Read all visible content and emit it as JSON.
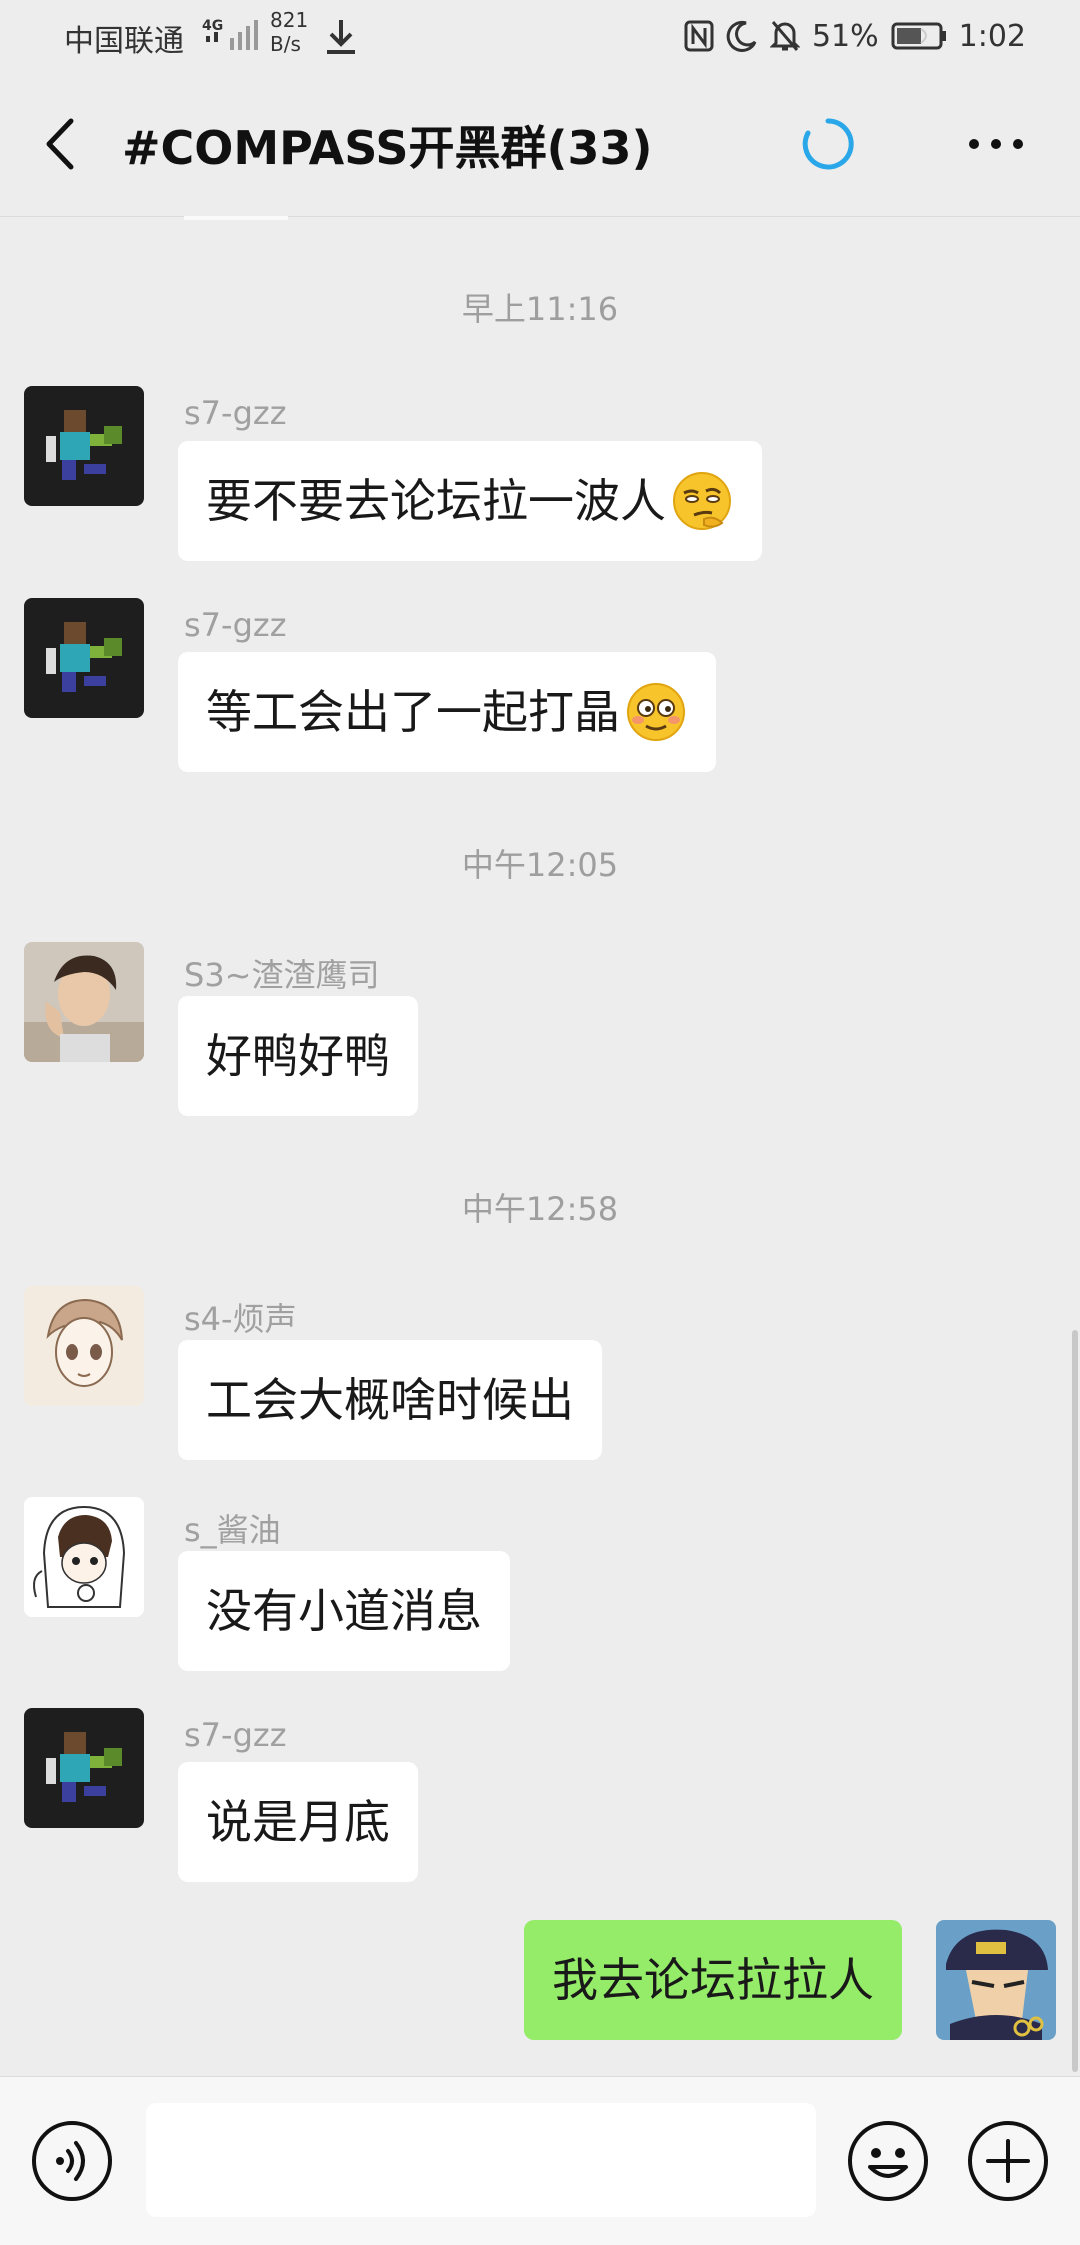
{
  "status_bar": {
    "carrier": "中国联通",
    "network": "4G",
    "speed_value": "821",
    "speed_unit": "B/s",
    "battery": "51%",
    "time": "1:02"
  },
  "header": {
    "title": "#COMPASS开黑群(33)",
    "back_icon": "back-arrow-icon",
    "loading_icon": "loading-spinner-icon",
    "more_icon": "more-dots-icon"
  },
  "chat": {
    "timestamps": [
      "早上11:16",
      "中午12:05",
      "中午12:58"
    ],
    "messages": [
      {
        "sender": "s7-gzz",
        "text": "要不要去论坛拉一波人",
        "emoji": "smirk-face"
      },
      {
        "sender": "s7-gzz",
        "text": "等工会出了一起打晶",
        "emoji": "flushed-face"
      },
      {
        "sender": "S3~渣渣鹰司",
        "text": "好鸭好鸭"
      },
      {
        "sender": "s4-烦声",
        "text": "工会大概啥时候出"
      },
      {
        "sender": "s_酱油",
        "text": "没有小道消息"
      },
      {
        "sender": "s7-gzz",
        "text": "说是月底"
      },
      {
        "sender": "me",
        "text": "我去论坛拉拉人"
      }
    ]
  },
  "input_bar": {
    "placeholder": "",
    "voice_icon": "voice-icon",
    "emoji_icon": "emoji-icon",
    "plus_icon": "plus-icon"
  },
  "colors": {
    "background": "#ededed",
    "bubble_in": "#ffffff",
    "bubble_out": "#95ec69",
    "accent_spinner": "#2aa7e8"
  }
}
